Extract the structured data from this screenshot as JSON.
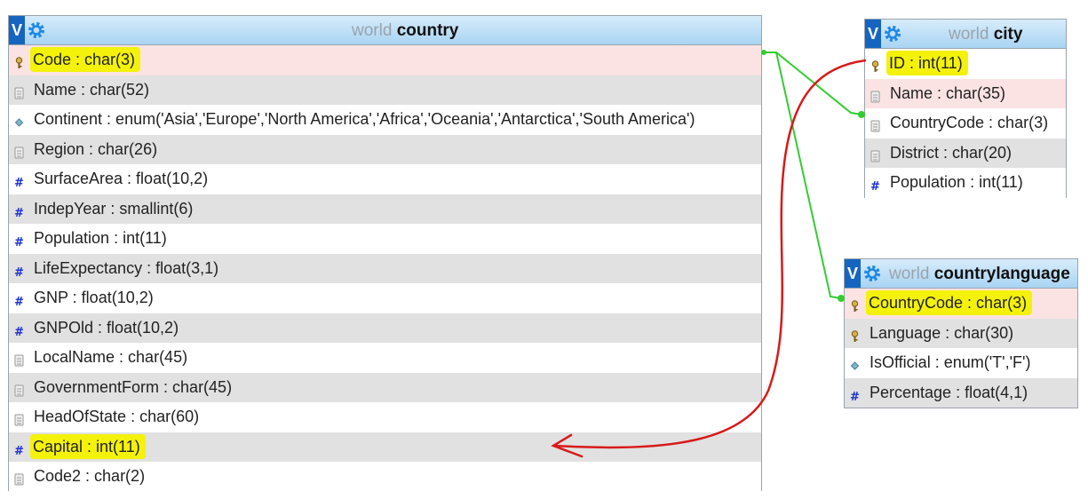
{
  "tables": {
    "country": {
      "db": "world",
      "name": "country",
      "columns": [
        {
          "label": "Code : char(3)",
          "icon": "key-icon",
          "highlight": true,
          "pk": true
        },
        {
          "label": "Name : char(52)",
          "icon": "text-field-icon"
        },
        {
          "label": "Continent : enum('Asia','Europe','North America','Africa','Oceania','Antarctica','South America')",
          "icon": "enum-icon"
        },
        {
          "label": "Region : char(26)",
          "icon": "text-field-icon"
        },
        {
          "label": "SurfaceArea : float(10,2)",
          "icon": "number-icon"
        },
        {
          "label": "IndepYear : smallint(6)",
          "icon": "number-icon"
        },
        {
          "label": "Population : int(11)",
          "icon": "number-icon"
        },
        {
          "label": "LifeExpectancy : float(3,1)",
          "icon": "number-icon"
        },
        {
          "label": "GNP : float(10,2)",
          "icon": "number-icon"
        },
        {
          "label": "GNPOld : float(10,2)",
          "icon": "number-icon"
        },
        {
          "label": "LocalName : char(45)",
          "icon": "text-field-icon"
        },
        {
          "label": "GovernmentForm : char(45)",
          "icon": "text-field-icon"
        },
        {
          "label": "HeadOfState : char(60)",
          "icon": "text-field-icon"
        },
        {
          "label": "Capital : int(11)",
          "icon": "number-icon",
          "highlight": true
        },
        {
          "label": "Code2 : char(2)",
          "icon": "text-field-icon"
        }
      ]
    },
    "city": {
      "db": "world",
      "name": "city",
      "columns": [
        {
          "label": "ID : int(11)",
          "icon": "key-icon",
          "highlight": true
        },
        {
          "label": "Name : char(35)",
          "icon": "text-field-icon",
          "pk": true
        },
        {
          "label": "CountryCode : char(3)",
          "icon": "text-field-icon"
        },
        {
          "label": "District : char(20)",
          "icon": "text-field-icon"
        },
        {
          "label": "Population : int(11)",
          "icon": "number-icon"
        }
      ]
    },
    "countrylanguage": {
      "db": "world",
      "name": "countrylanguage",
      "columns": [
        {
          "label": "CountryCode : char(3)",
          "icon": "key-icon",
          "highlight": true,
          "pk": true
        },
        {
          "label": "Language : char(30)",
          "icon": "key-icon"
        },
        {
          "label": "IsOfficial : enum('T','F')",
          "icon": "enum-icon"
        },
        {
          "label": "Percentage : float(4,1)",
          "icon": "number-icon"
        }
      ]
    }
  },
  "toggle_label": "V",
  "colors": {
    "relation_line": "#33cc33",
    "annotation_arrow": "#d71a1a",
    "highlight": "#f4f20a"
  }
}
